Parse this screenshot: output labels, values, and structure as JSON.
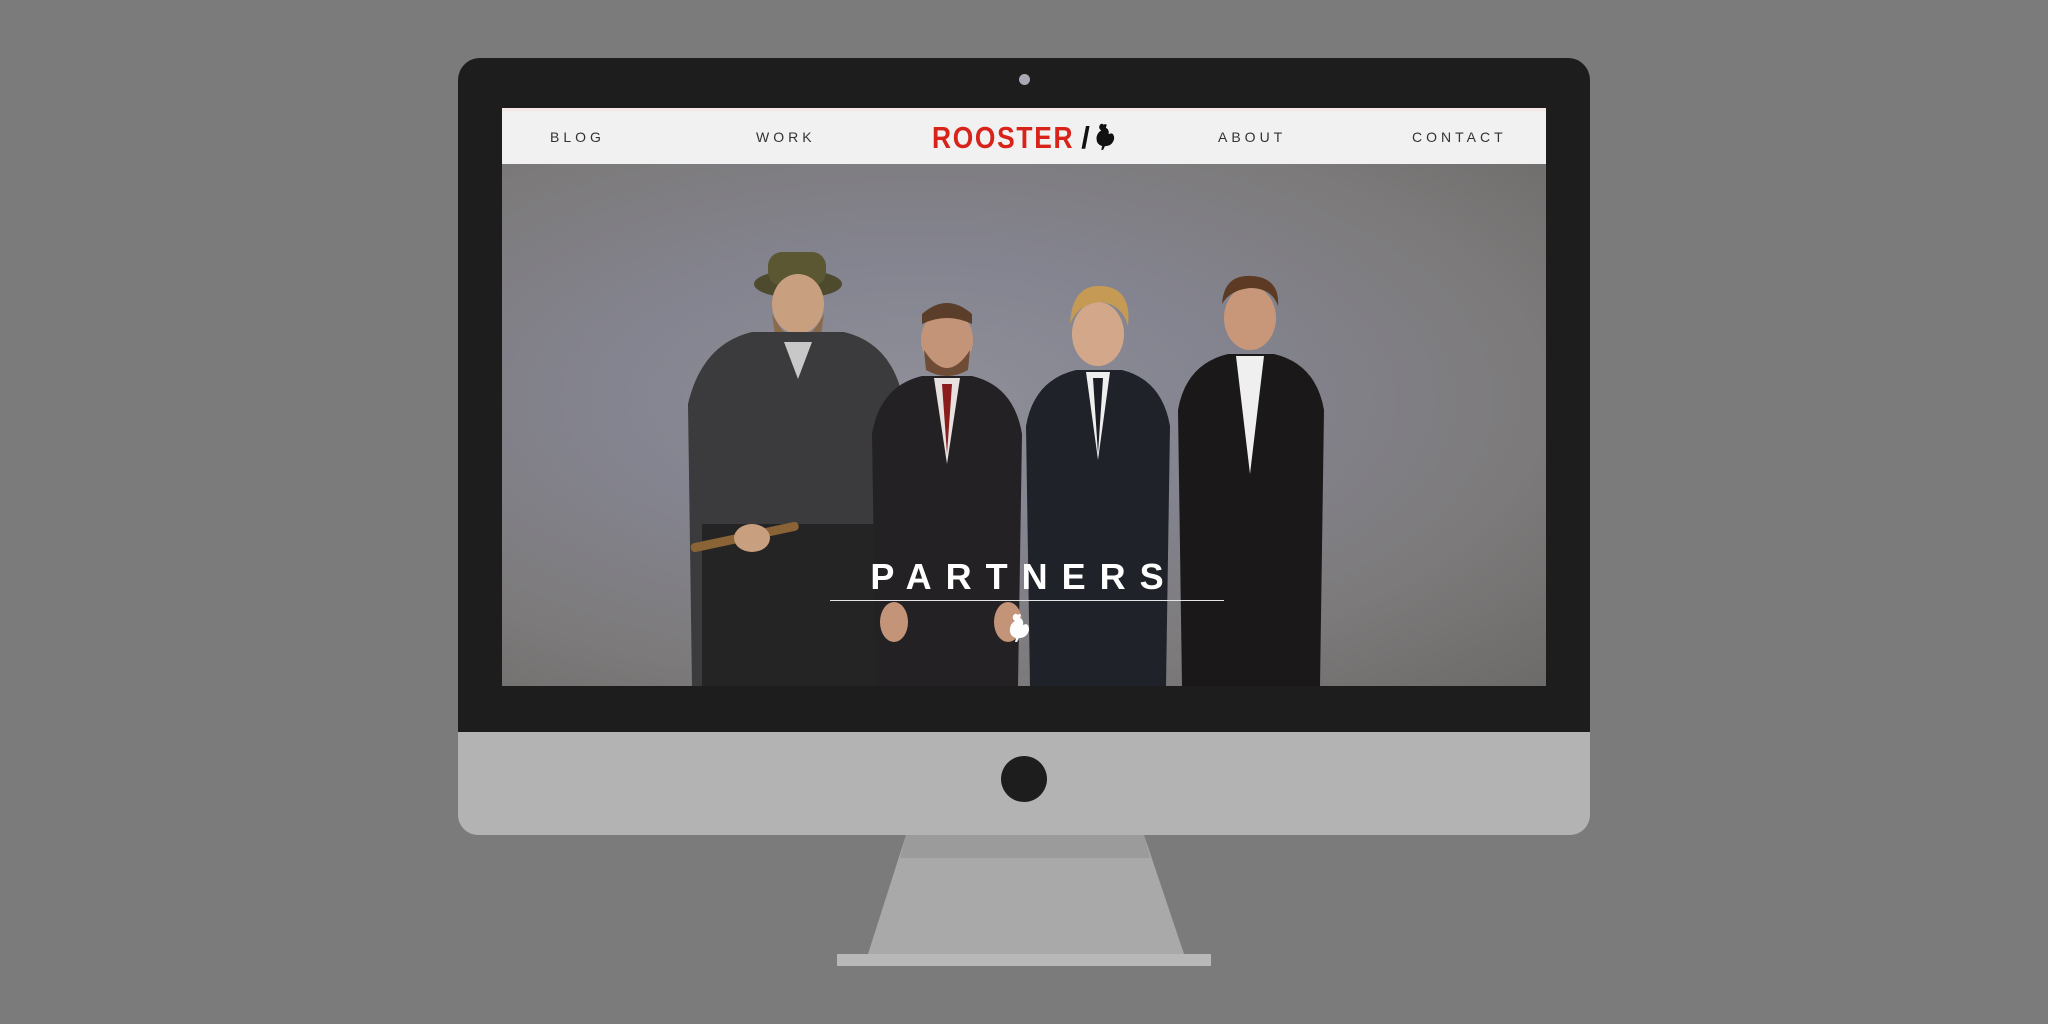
{
  "nav": {
    "blog": "BLOG",
    "work": "WORK",
    "about": "ABOUT",
    "contact": "CONTACT",
    "brand": "ROOSTER",
    "brand_slash": "/",
    "brand_icon": "rooster-icon"
  },
  "hero": {
    "title": "PARTNERS",
    "icon": "rooster-icon",
    "image": "four-men-in-suits-portrait"
  },
  "colors": {
    "brand_red": "#d8231b",
    "backdrop": "#7b7b7b",
    "bezel": "#1d1d1d"
  }
}
